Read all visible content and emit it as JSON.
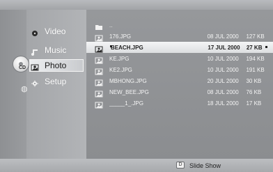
{
  "menu": {
    "items": [
      {
        "label": "Video",
        "icon": "video-icon",
        "active": false
      },
      {
        "label": "Music",
        "icon": "music-icon",
        "active": false
      },
      {
        "label": "Photo",
        "icon": "photo-icon",
        "active": true
      },
      {
        "label": "Setup",
        "icon": "setup-icon",
        "active": false
      }
    ]
  },
  "device": {
    "label": "CD",
    "icon": "cd-disc-icon"
  },
  "network": {
    "icon": "globe-icon"
  },
  "files": [
    {
      "name": "..",
      "type": "folder",
      "date": "",
      "size": ""
    },
    {
      "name": "176.JPG",
      "type": "photo",
      "date": "08 JUL 2000",
      "size": "127 KB"
    },
    {
      "name": "BEACH.JPG",
      "type": "photo",
      "date": "17 JUL 2000",
      "size": "27 KB",
      "selected": true
    },
    {
      "name": "KE.JPG",
      "type": "photo",
      "date": "10 JUL 2000",
      "size": "194 KB"
    },
    {
      "name": "KE2.JPG",
      "type": "photo",
      "date": "10 JUL 2000",
      "size": "191 KB"
    },
    {
      "name": "MBHONG.JPG",
      "type": "photo",
      "date": "20 JUL 2000",
      "size": "30 KB"
    },
    {
      "name": "NEW_BEE.JPG",
      "type": "photo",
      "date": "08 JUL 2000",
      "size": "76 KB"
    },
    {
      "name": "_____1_.JPG",
      "type": "photo",
      "date": "18 JUL 2000",
      "size": "17 KB"
    }
  ],
  "footer": {
    "button_label": "D",
    "action_label": "Slide Show"
  }
}
